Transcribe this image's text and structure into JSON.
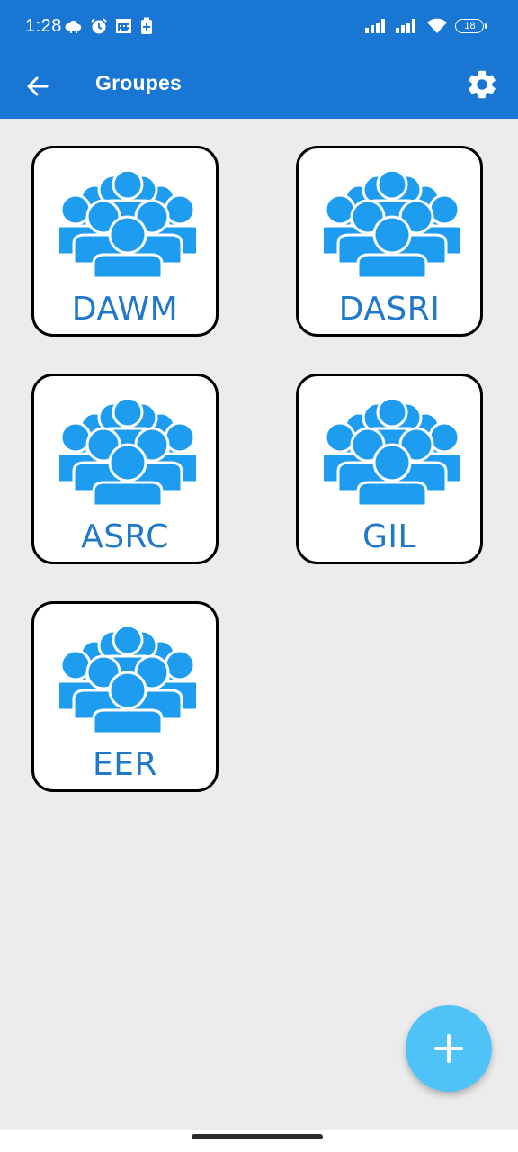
{
  "status_bar": {
    "time": "1:28",
    "battery": "18",
    "left_icons": [
      "cloud-sync-icon",
      "alarm-icon",
      "calendar-icon",
      "battery-saver-icon"
    ],
    "right_icons": [
      "signal-1-icon",
      "signal-2-icon",
      "wifi-icon",
      "battery-icon"
    ]
  },
  "app_bar": {
    "title": "Groupes",
    "back_icon": "arrow-left-icon",
    "settings_icon": "gear-icon"
  },
  "groups": [
    {
      "label": "DAWM",
      "icon": "people-group-icon"
    },
    {
      "label": "DASRI",
      "icon": "people-group-icon"
    },
    {
      "label": "ASRC",
      "icon": "people-group-icon"
    },
    {
      "label": "GIL",
      "icon": "people-group-icon"
    },
    {
      "label": "EER",
      "icon": "people-group-icon"
    }
  ],
  "fab": {
    "icon": "plus-icon"
  },
  "colors": {
    "primary": "#1976d2",
    "group_icon": "#1e9cf0",
    "group_label": "#1f78c9",
    "fab": "#4fc3f7",
    "background": "#ececec"
  }
}
